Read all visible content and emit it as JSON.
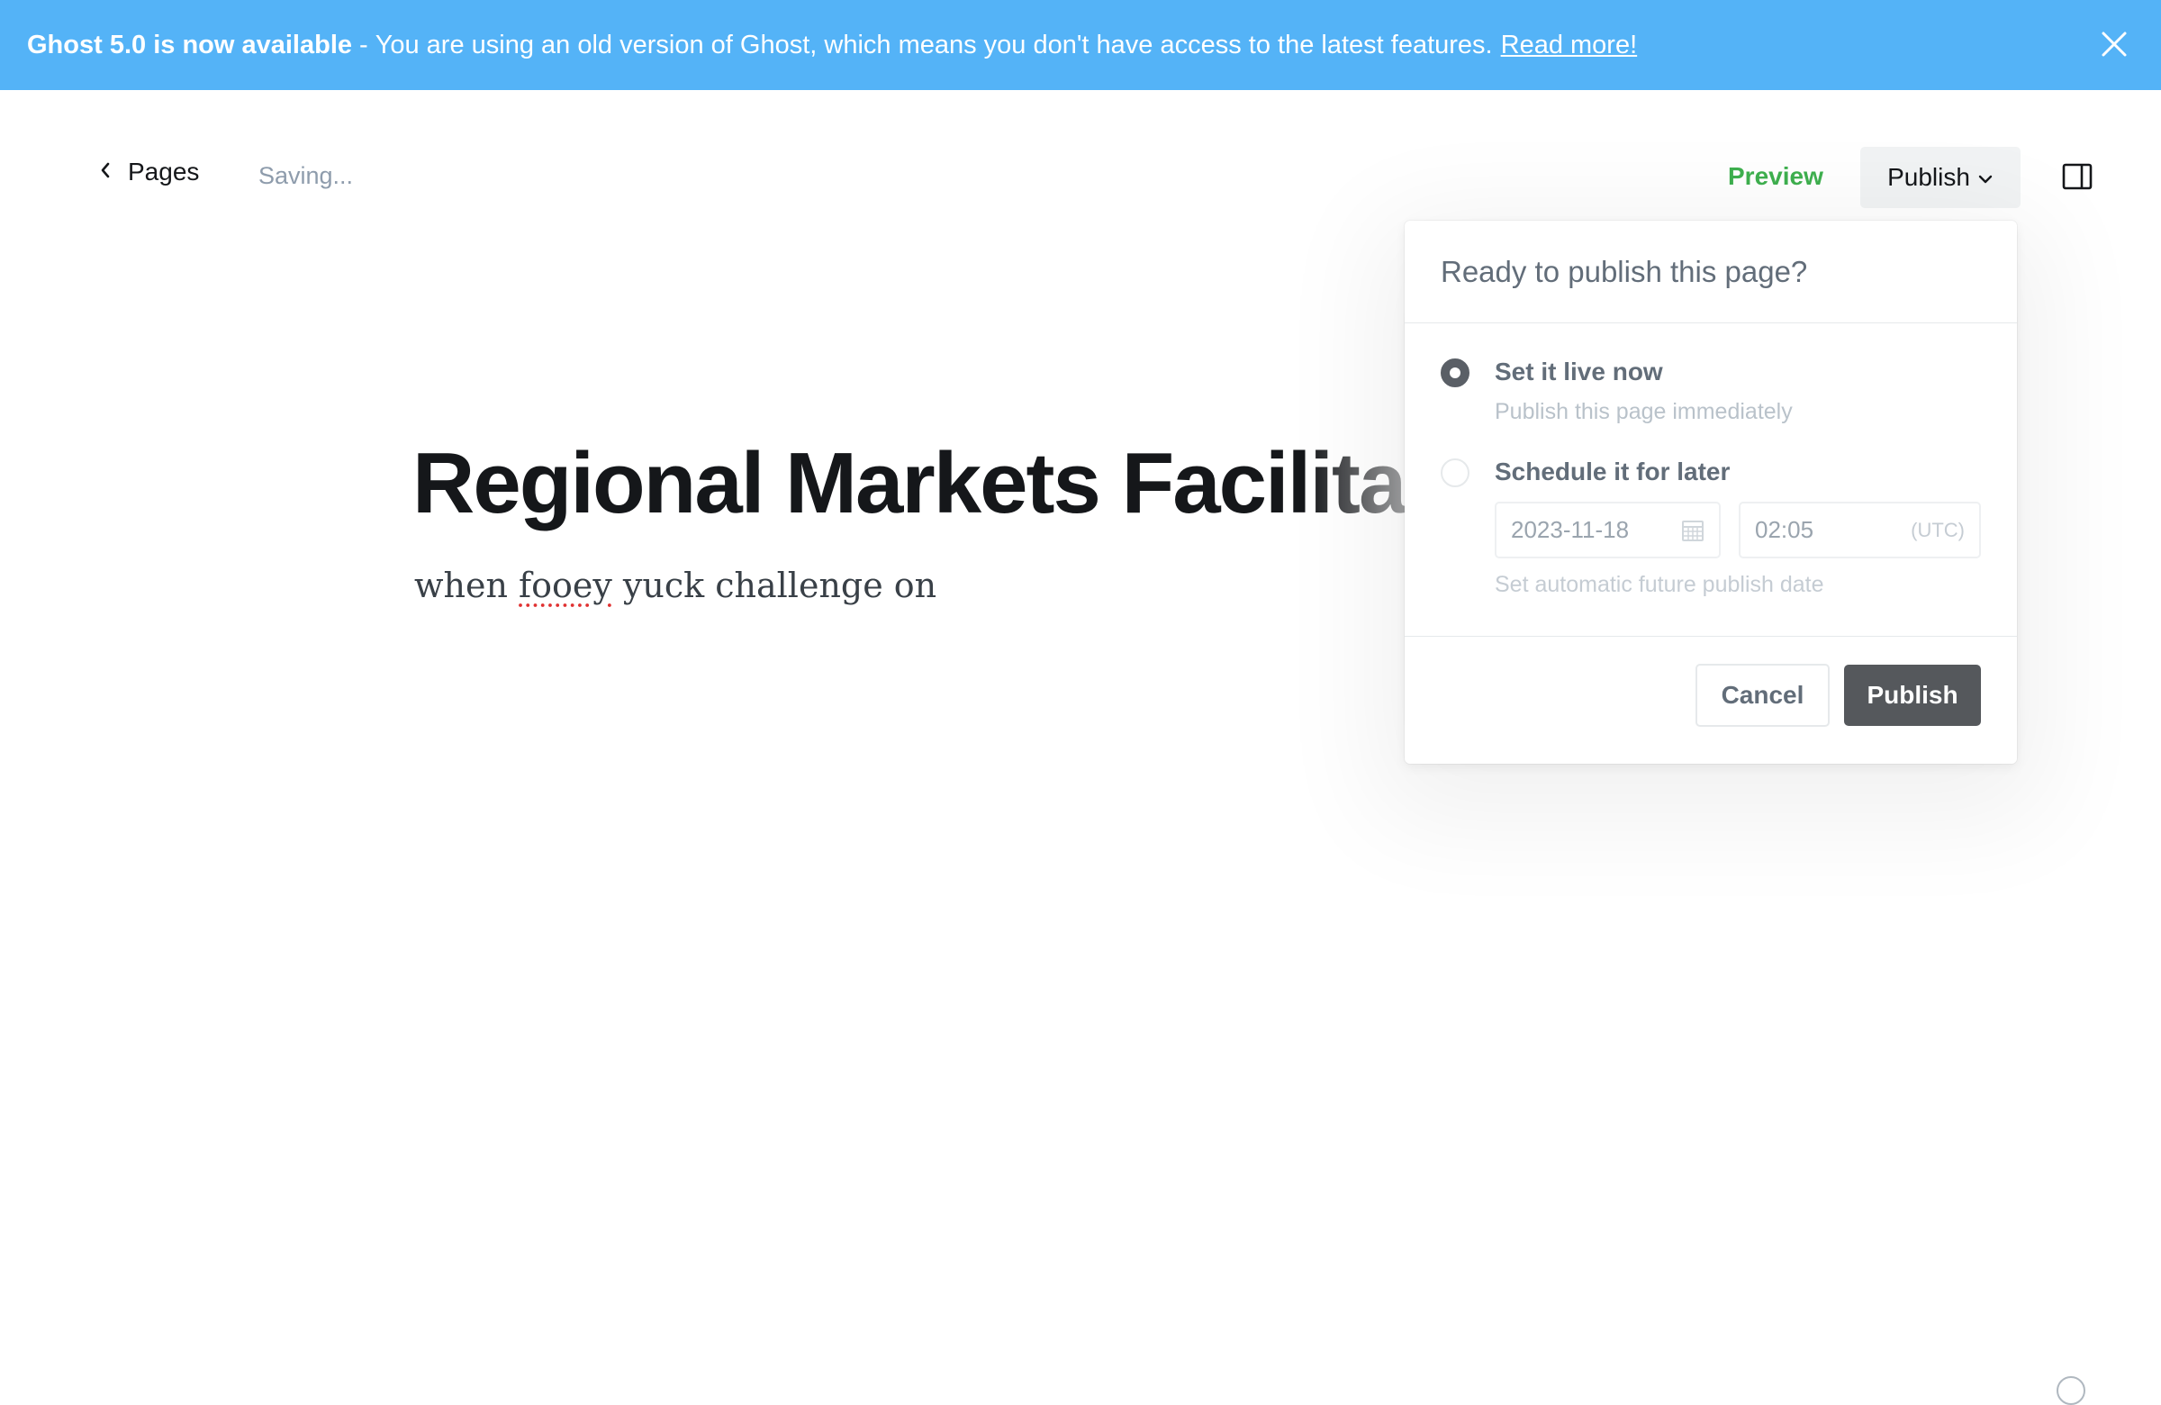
{
  "banner": {
    "bold_text": "Ghost 5.0 is now available",
    "separator": "-",
    "message": "You are using an old version of Ghost, which means you don't have access to the latest features.",
    "link_text": "Read more!",
    "background": "#54b3f7"
  },
  "toolbar": {
    "back_label": "Pages",
    "status": "Saving...",
    "preview_label": "Preview",
    "publish_label": "Publish"
  },
  "editor": {
    "title": "Regional Markets Facilitator",
    "body_before": "when ",
    "body_misspelled": "fooey",
    "body_after": " yuck challenge on"
  },
  "publish_panel": {
    "heading": "Ready to publish this page?",
    "option_now": {
      "title": "Set it live now",
      "description": "Publish this page immediately",
      "selected": true
    },
    "option_later": {
      "title": "Schedule it for later",
      "date": "2023-11-18",
      "time": "02:05",
      "timezone": "(UTC)",
      "help": "Set automatic future publish date",
      "selected": false
    },
    "cancel_label": "Cancel",
    "publish_label": "Publish"
  }
}
